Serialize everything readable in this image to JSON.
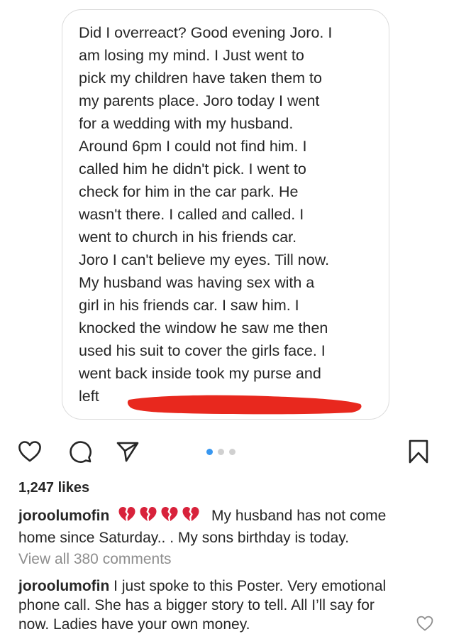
{
  "post_image": {
    "message_lines": [
      "Did I overreact? Good evening Joro. I",
      "am losing my mind. I Just went to",
      "pick my children have taken them to",
      "my parents place. Joro today I went",
      "for a wedding with my husband.",
      "Around 6pm I could not find him. I",
      "called him he didn't pick. I went to",
      "check for him in the car park. He",
      "wasn't there. I called and called. I",
      "went to church in his friends car.",
      "Joro I can't believe my eyes. Till now.",
      "My husband was having sex with a",
      "girl in his friends car. I saw him. I",
      "knocked the window he saw me then",
      "used his suit to cover the girls face. I",
      "went back inside took my purse and",
      "left"
    ],
    "redaction_color": "#e8281e"
  },
  "actions": {
    "like_icon": "heart-outline-icon",
    "comment_icon": "speech-bubble-icon",
    "share_icon": "paper-plane-icon",
    "save_icon": "bookmark-icon"
  },
  "carousel": {
    "total": 3,
    "active_index": 0,
    "active_color": "#3897f0",
    "inactive_color": "#d0d0d0"
  },
  "likes": {
    "text": "1,247 likes"
  },
  "caption": {
    "username": "joroolumofin",
    "emojis": [
      "broken-heart-icon",
      "broken-heart-icon",
      "broken-heart-icon",
      "broken-heart-icon"
    ],
    "emoji_color": "#d8223b",
    "text": "My husband has not come home since Saturday.. . My sons birthday is today."
  },
  "view_comments": {
    "text": "View all 380 comments"
  },
  "comment": {
    "username": "joroolumofin",
    "text": "I just spoke to this Poster. Very emotional phone call. She has a bigger story to tell. All I’ll say for now. Ladies have your own money.",
    "like_icon": "small-heart-outline-icon"
  }
}
